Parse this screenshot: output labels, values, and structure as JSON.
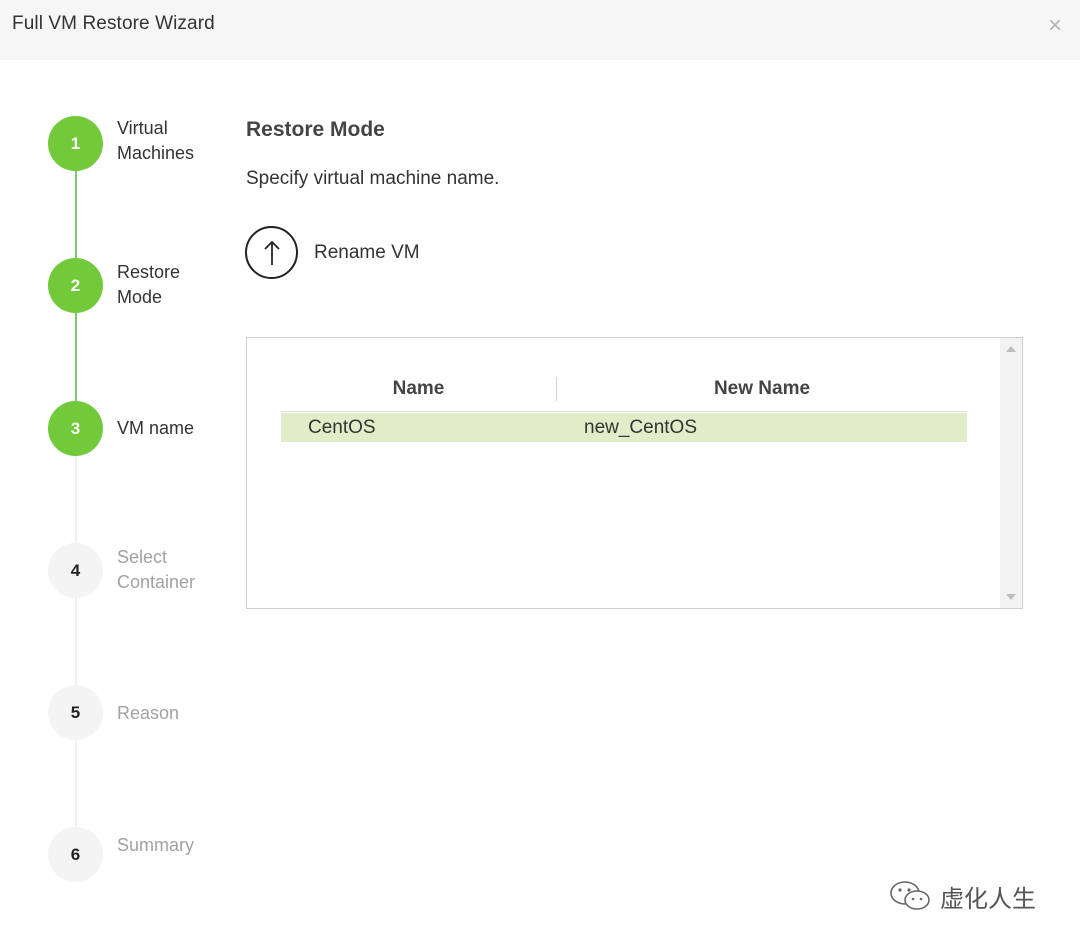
{
  "window": {
    "title": "Full VM Restore Wizard",
    "close_symbol": "×"
  },
  "steps": [
    {
      "number": "1",
      "label": "Virtual Machines",
      "state": "completed"
    },
    {
      "number": "2",
      "label": "Restore Mode",
      "state": "completed"
    },
    {
      "number": "3",
      "label": "VM name",
      "state": "current"
    },
    {
      "number": "4",
      "label": "Select Container",
      "state": "pending"
    },
    {
      "number": "5",
      "label": "Reason",
      "state": "pending"
    },
    {
      "number": "6",
      "label": "Summary",
      "state": "pending"
    }
  ],
  "main": {
    "heading": "Restore Mode",
    "subtext": "Specify virtual machine name.",
    "rename_button": {
      "label": "Rename VM",
      "icon": "arrow-up-icon"
    },
    "table": {
      "columns": [
        "Name",
        "New Name"
      ],
      "rows": [
        {
          "name": "CentOS",
          "new_name": "new_CentOS",
          "selected": true
        }
      ]
    }
  },
  "watermark": {
    "text": "虚化人生",
    "icon": "wechat-icon"
  },
  "colors": {
    "active_step": "#72c93a",
    "completed_line": "#7bc96f",
    "selected_row": "#e1ecc9",
    "titlebar_bg": "#f6f6f6"
  }
}
